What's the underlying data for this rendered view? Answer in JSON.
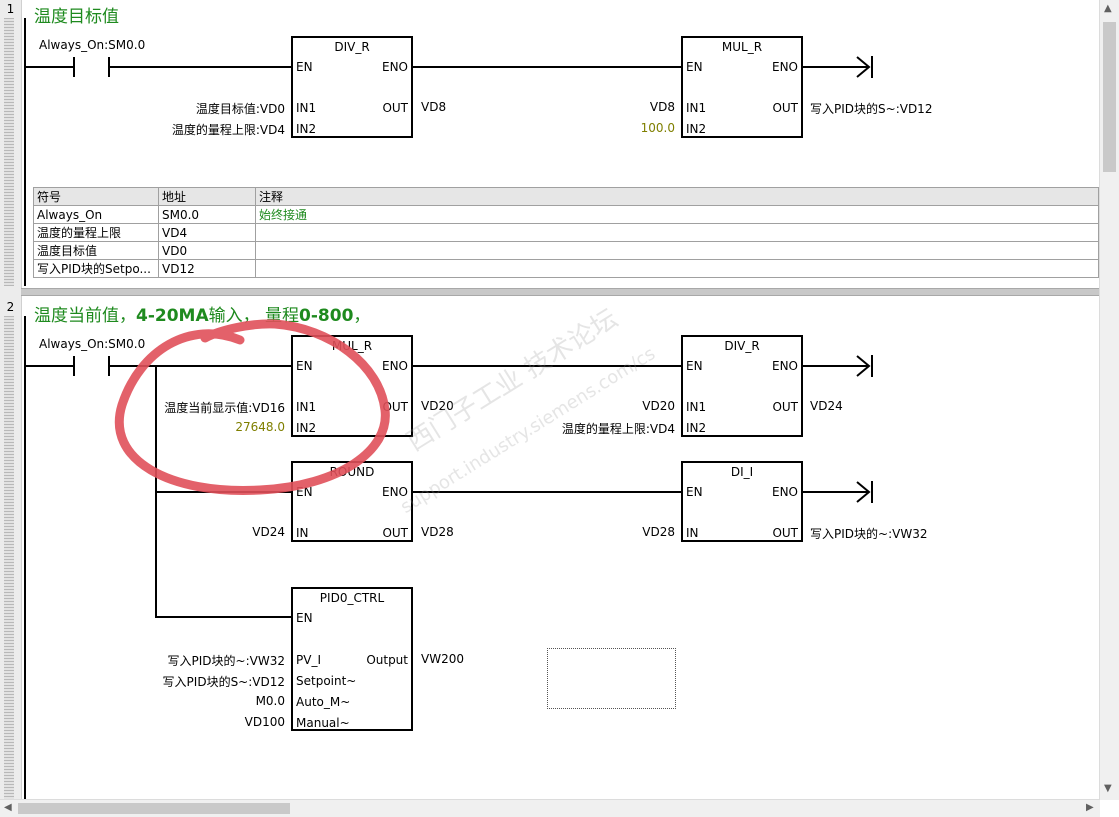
{
  "networks": [
    {
      "number": "1",
      "title": "温度目标值"
    },
    {
      "number": "2",
      "title_a": "温度当前值，",
      "title_b": "4-20MA",
      "title_c": "输入，  量程",
      "title_d": "0-800",
      "title_e": "，"
    }
  ],
  "net1": {
    "contact_label": "Always_On:SM0.0",
    "div_r": {
      "name": "DIV_R",
      "en": "EN",
      "eno": "ENO",
      "in1": "IN1",
      "in2": "IN2",
      "out": "OUT",
      "in1_val": "温度目标值:VD0",
      "in2_val": "温度的量程上限:VD4",
      "out_val": "VD8"
    },
    "mul_r": {
      "name": "MUL_R",
      "en": "EN",
      "eno": "ENO",
      "in1": "IN1",
      "in2": "IN2",
      "out": "OUT",
      "in1_val": "VD8",
      "in2_val": "100.0",
      "out_val": "写入PID块的S~:VD12"
    }
  },
  "symbol_table": {
    "headers": [
      "符号",
      "地址",
      "注释"
    ],
    "rows": [
      [
        "Always_On",
        "SM0.0",
        "始终接通"
      ],
      [
        "温度的量程上限",
        "VD4",
        ""
      ],
      [
        "温度目标值",
        "VD0",
        ""
      ],
      [
        "写入PID块的Setpo...",
        "VD12",
        ""
      ]
    ]
  },
  "net2": {
    "contact_label": "Always_On:SM0.0",
    "mul_r": {
      "name": "MUL_R",
      "en": "EN",
      "eno": "ENO",
      "in1": "IN1",
      "in2": "IN2",
      "out": "OUT",
      "in1_val": "温度当前显示值:VD16",
      "in2_val": "27648.0",
      "out_val": "VD20"
    },
    "div_r": {
      "name": "DIV_R",
      "en": "EN",
      "eno": "ENO",
      "in1": "IN1",
      "in2": "IN2",
      "out": "OUT",
      "in1_val": "VD20",
      "in2_val": "温度的量程上限:VD4",
      "out_val": "VD24"
    },
    "round": {
      "name": "ROUND",
      "en": "EN",
      "eno": "ENO",
      "in": "IN",
      "out": "OUT",
      "in_val": "VD24",
      "out_val": "VD28"
    },
    "di_i": {
      "name": "DI_I",
      "en": "EN",
      "eno": "ENO",
      "in": "IN",
      "out": "OUT",
      "in_val": "VD28",
      "out_val": "写入PID块的~:VW32"
    },
    "pid": {
      "name": "PID0_CTRL",
      "en": "EN",
      "pv": "PV_I",
      "sp": "Setpoint~",
      "auto": "Auto_M~",
      "man": "Manual~",
      "out": "Output",
      "pv_val": "写入PID块的~:VW32",
      "sp_val": "写入PID块的S~:VD12",
      "auto_val": "M0.0",
      "man_val": "VD100",
      "out_val": "VW200"
    }
  },
  "watermark": "西门子工业  技术论坛",
  "watermark2": "support.industry.siemens.com/cs",
  "colors": {
    "title": "#1e8a1e",
    "constant": "#7f7f00",
    "annotation": "#e0505a"
  }
}
